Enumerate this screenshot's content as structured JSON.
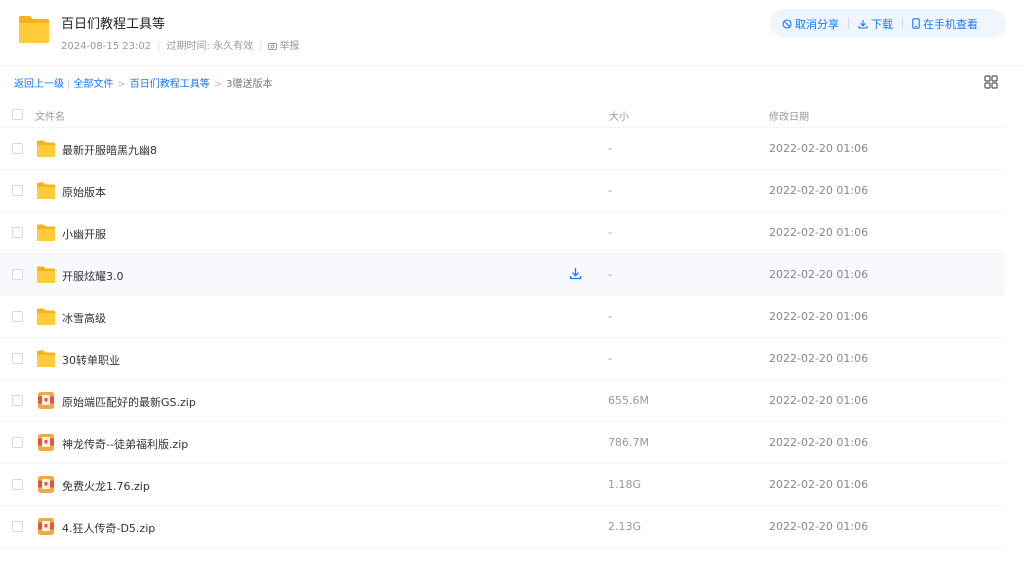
{
  "header": {
    "title": "百日们教程工具等",
    "date": "2024-08-15 23:02",
    "expiry_label": "过期时间: 永久有效",
    "report_label": "举报",
    "actions": {
      "cancel_share": "取消分享",
      "download": "下载",
      "view_on_phone": "在手机查看"
    },
    "accent_color": "#1677ff"
  },
  "breadcrumb": {
    "back": "返回上一级",
    "all_files": "全部文件",
    "folder": "百日们教程工具等",
    "current": "3赠送版本"
  },
  "table": {
    "columns": {
      "name": "文件名",
      "size": "大小",
      "modified": "修改日期"
    },
    "rows": [
      {
        "type": "folder",
        "name": "最新开服暗黑九幽8",
        "size": "-",
        "modified": "2022-02-20 01:06"
      },
      {
        "type": "folder",
        "name": "原始版本",
        "size": "-",
        "modified": "2022-02-20 01:06"
      },
      {
        "type": "folder",
        "name": "小幽开服",
        "size": "-",
        "modified": "2022-02-20 01:06"
      },
      {
        "type": "folder",
        "name": "开服炫耀3.0",
        "size": "-",
        "modified": "2022-02-20 01:06",
        "hovered": true
      },
      {
        "type": "folder",
        "name": "冰雪高级",
        "size": "-",
        "modified": "2022-02-20 01:06"
      },
      {
        "type": "folder",
        "name": "30转单职业",
        "size": "-",
        "modified": "2022-02-20 01:06"
      },
      {
        "type": "zip",
        "name": "原始端匹配好的最新GS.zip",
        "size": "655.6M",
        "modified": "2022-02-20 01:06"
      },
      {
        "type": "zip",
        "name": "神龙传奇--徒弟福利版.zip",
        "size": "786.7M",
        "modified": "2022-02-20 01:06"
      },
      {
        "type": "zip",
        "name": "免费火龙1.76.zip",
        "size": "1.18G",
        "modified": "2022-02-20 01:06"
      },
      {
        "type": "zip",
        "name": "4.狂人传奇-D5.zip",
        "size": "2.13G",
        "modified": "2022-02-20 01:06"
      }
    ]
  }
}
